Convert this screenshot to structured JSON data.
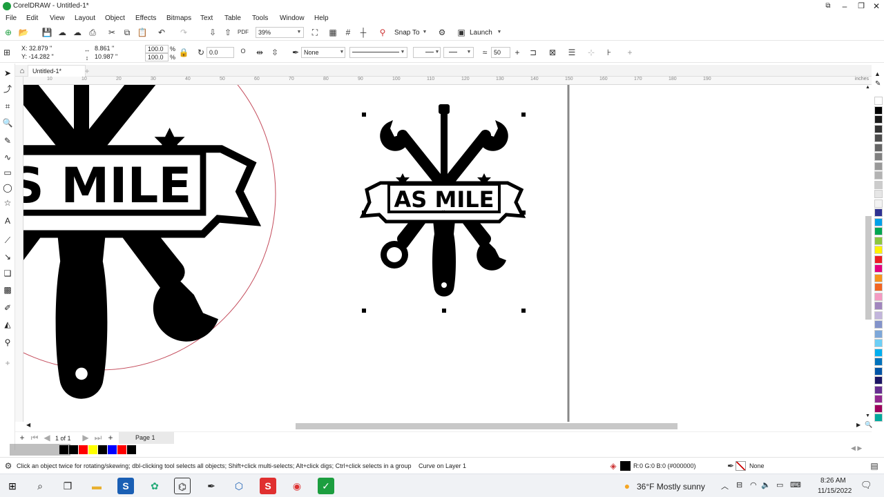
{
  "titlebar": {
    "title": "CorelDRAW - Untitled-1*"
  },
  "menu": [
    "File",
    "Edit",
    "View",
    "Layout",
    "Object",
    "Effects",
    "Bitmaps",
    "Text",
    "Table",
    "Tools",
    "Window",
    "Help"
  ],
  "stdbar": {
    "zoom": "39%",
    "snap_label": "Snap To",
    "launch_label": "Launch"
  },
  "propbar": {
    "x": "X: 32.879 \"",
    "y": "Y: -14.282 \"",
    "w": "8.861 \"",
    "h": "10.987 \"",
    "scale_w": "100.0",
    "scale_h": "100.0",
    "pct": "%",
    "rotation": "0.0",
    "outline": "None",
    "smooth": "50"
  },
  "doc_tab": "Untitled-1*",
  "ruler_unit": "inches",
  "ruler_ticks": [
    "10",
    "10",
    "20",
    "30",
    "40",
    "50",
    "60",
    "70",
    "80",
    "90",
    "100",
    "110",
    "120",
    "130",
    "140",
    "150",
    "160",
    "170",
    "180",
    "190"
  ],
  "pagebar": {
    "counter": "1 of 1",
    "page": "Page 1"
  },
  "logo_text": "AS MILE",
  "status": {
    "hint": "Click an object twice for rotating/skewing; dbl-clicking tool selects all objects; Shift+click multi-selects; Alt+click digs; Ctrl+click selects in a group",
    "object": "Curve on Layer 1",
    "fill": "R:0 G:0 B:0 (#000000)",
    "outline": "None"
  },
  "taskbar": {
    "weather": "36°F  Mostly sunny",
    "time": "8:26 AM",
    "date": "11/15/2022"
  },
  "colors": {
    "palette": [
      "#ffffff",
      "#000000",
      "#1a1a1a",
      "#333333",
      "#4d4d4d",
      "#666666",
      "#808080",
      "#999999",
      "#b3b3b3",
      "#cccccc",
      "#e6e6e6",
      "#f2f2f2",
      "#2e3192",
      "#00a0e9",
      "#00a651",
      "#8dc63f",
      "#fff200",
      "#ed1c24",
      "#e4007f",
      "#f7941d",
      "#f26522",
      "#f49ac2",
      "#a186be",
      "#c2b5dc",
      "#8393ca",
      "#7da7d9",
      "#6dcff6",
      "#00aeef",
      "#0072bc",
      "#0054a6",
      "#1b1464",
      "#662d91",
      "#92278f",
      "#9e005d",
      "#00a99d"
    ],
    "docked": [
      "#000000",
      "#000000",
      "#ff0000",
      "#ffff00",
      "#000000",
      "#0000ff",
      "#ff0000",
      "#000000"
    ]
  }
}
